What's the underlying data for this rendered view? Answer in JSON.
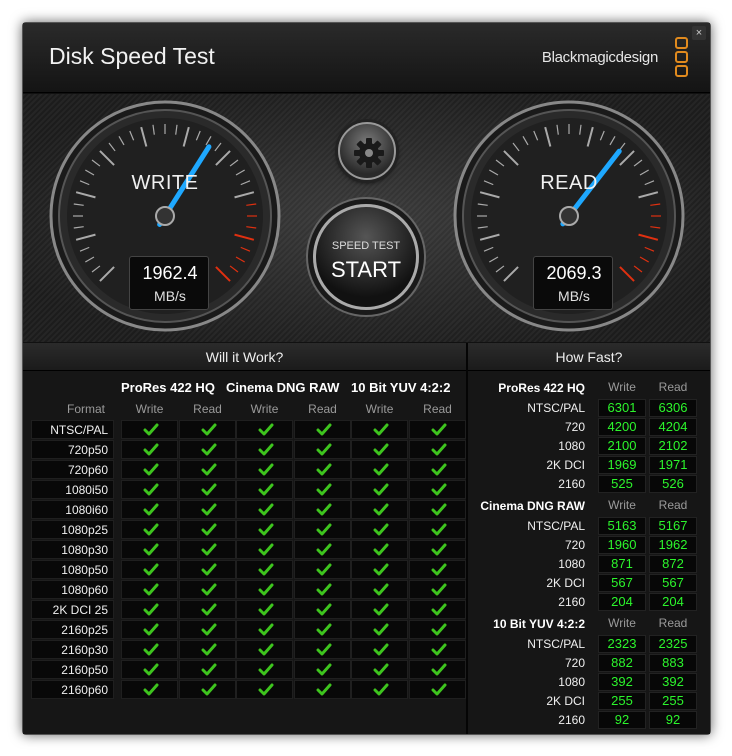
{
  "window": {
    "title": "Disk Speed Test",
    "brand": "Blackmagicdesign",
    "close_glyph": "×"
  },
  "gauges": {
    "write": {
      "label": "WRITE",
      "value": "1962.4",
      "unit": "MB/s",
      "needle_fraction": 0.62
    },
    "read": {
      "label": "READ",
      "value": "2069.3",
      "unit": "MB/s",
      "needle_fraction": 0.64
    }
  },
  "controls": {
    "start_sub": "SPEED TEST",
    "start_main": "START",
    "settings_icon": "gear-icon"
  },
  "colors": {
    "needle": "#1ea8ff",
    "check": "#3ec41e",
    "speed_value": "#2cf52c",
    "logo": "#e08a1e",
    "danger_zone": "#e03010"
  },
  "will_it_work": {
    "title": "Will it Work?",
    "format_label": "Format",
    "codecs": [
      {
        "name": "ProRes 422 HQ",
        "sub": [
          "Write",
          "Read"
        ]
      },
      {
        "name": "Cinema DNG RAW",
        "sub": [
          "Write",
          "Read"
        ]
      },
      {
        "name": "10 Bit YUV 4:2:2",
        "sub": [
          "Write",
          "Read"
        ]
      }
    ],
    "check_icon": "checkmark-icon",
    "rows": [
      "NTSC/PAL",
      "720p50",
      "720p60",
      "1080i50",
      "1080i60",
      "1080p25",
      "1080p30",
      "1080p50",
      "1080p60",
      "2K DCI 25",
      "2160p25",
      "2160p30",
      "2160p50",
      "2160p60"
    ]
  },
  "how_fast": {
    "title": "How Fast?",
    "groups": [
      {
        "name": "ProRes 422 HQ",
        "sub": [
          "Write",
          "Read"
        ],
        "rows": [
          {
            "label": "NTSC/PAL",
            "write": "6301",
            "read": "6306"
          },
          {
            "label": "720",
            "write": "4200",
            "read": "4204"
          },
          {
            "label": "1080",
            "write": "2100",
            "read": "2102"
          },
          {
            "label": "2K DCI",
            "write": "1969",
            "read": "1971"
          },
          {
            "label": "2160",
            "write": "525",
            "read": "526"
          }
        ]
      },
      {
        "name": "Cinema DNG RAW",
        "sub": [
          "Write",
          "Read"
        ],
        "rows": [
          {
            "label": "NTSC/PAL",
            "write": "5163",
            "read": "5167"
          },
          {
            "label": "720",
            "write": "1960",
            "read": "1962"
          },
          {
            "label": "1080",
            "write": "871",
            "read": "872"
          },
          {
            "label": "2K DCI",
            "write": "567",
            "read": "567"
          },
          {
            "label": "2160",
            "write": "204",
            "read": "204"
          }
        ]
      },
      {
        "name": "10 Bit YUV 4:2:2",
        "sub": [
          "Write",
          "Read"
        ],
        "rows": [
          {
            "label": "NTSC/PAL",
            "write": "2323",
            "read": "2325"
          },
          {
            "label": "720",
            "write": "882",
            "read": "883"
          },
          {
            "label": "1080",
            "write": "392",
            "read": "392"
          },
          {
            "label": "2K DCI",
            "write": "255",
            "read": "255"
          },
          {
            "label": "2160",
            "write": "92",
            "read": "92"
          }
        ]
      }
    ]
  }
}
